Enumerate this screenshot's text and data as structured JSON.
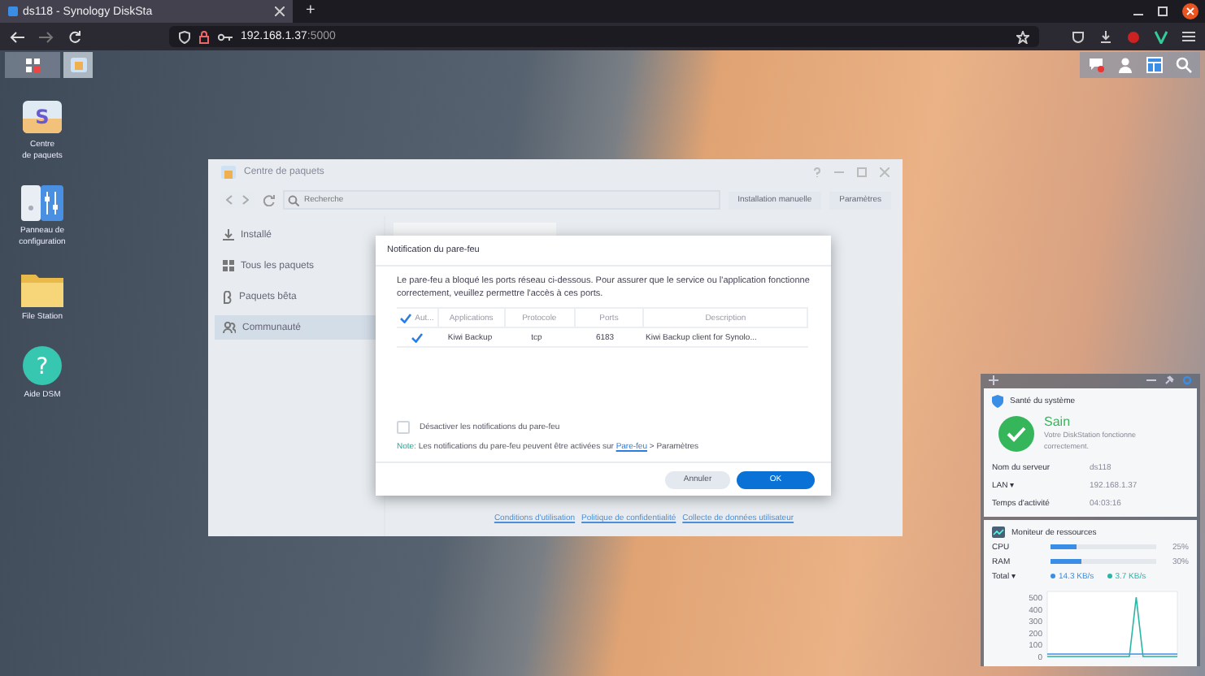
{
  "browser": {
    "tab_title": "ds118 - Synology DiskSta",
    "new_tab": "+",
    "url_host": "192.168.1.37",
    "url_port": ":5000"
  },
  "desktop_icons": [
    {
      "kind": "package",
      "glyph": "S",
      "lines": [
        "Centre",
        "de paquets"
      ]
    },
    {
      "kind": "config",
      "lines": [
        "Panneau de",
        "configuration"
      ]
    },
    {
      "kind": "folder",
      "lines": [
        "File Station"
      ]
    },
    {
      "kind": "help",
      "glyph": "?",
      "lines": [
        "Aide DSM"
      ]
    }
  ],
  "package_center": {
    "title": "Centre de paquets",
    "search": {
      "placeholder": "Recherche"
    },
    "buttons": [
      "Installation manuelle",
      "Paramètres"
    ],
    "sidebar": [
      {
        "label": "Installé",
        "kind": "download",
        "selected": false
      },
      {
        "label": "Tous les paquets",
        "kind": "grid",
        "selected": false
      },
      {
        "label": "Paquets bêta",
        "kind": "beta",
        "selected": false
      },
      {
        "label": "Communauté",
        "kind": "people",
        "selected": true
      }
    ],
    "footer_links": [
      "Conditions d'utilisation",
      "Politique de confidentialité",
      "Collecte de données utilisateur"
    ]
  },
  "dialog": {
    "title": "Notification du pare-feu",
    "message": "Le pare-feu a bloqué les ports réseau ci-dessous. Pour assurer que le service ou l'application fonctionne correctement, veuillez permettre l'accès à ces ports.",
    "table": {
      "header_checked": true,
      "columns": [
        "Aut...",
        "Applications",
        "Protocole",
        "Ports",
        "Description"
      ],
      "rows": [
        {
          "checked": true,
          "cells": [
            "",
            "Kiwi Backup",
            "tcp",
            "6183",
            "Kiwi Backup client for Synolo..."
          ]
        }
      ]
    },
    "disable_option": {
      "label": "Désactiver les notifications du pare-feu",
      "checked": false
    },
    "note": {
      "prefix": "Note:",
      "text": "Les notifications du pare-feu peuvent être activées sur",
      "link": "Pare-feu",
      "suffix": "> Paramètres"
    },
    "buttons": [
      {
        "label": "Annuler",
        "kind": "secondary"
      },
      {
        "label": "OK",
        "kind": "primary"
      }
    ]
  },
  "health_widget": {
    "title": "Santé du système",
    "status": "Sain",
    "description": "Votre DiskStation fonctionne correctement.",
    "rows": [
      {
        "label": "Nom du serveur",
        "value": "ds118"
      },
      {
        "label": "LAN ▾",
        "value": "192.168.1.37"
      },
      {
        "label": "Temps d'activité",
        "value": "04:03:16"
      }
    ]
  },
  "resource_widget": {
    "title": "Moniteur de ressources",
    "meters": [
      {
        "label": "CPU",
        "level": 0.25,
        "reading": "25%"
      },
      {
        "label": "RAM",
        "level": 0.3,
        "reading": "30%"
      }
    ],
    "network": {
      "label": "Total ▾",
      "readings": [
        {
          "text": "14.3 KB/s",
          "color": "#3a8ee6"
        },
        {
          "text": "3.7 KB/s",
          "color": "#2ab5a5"
        }
      ]
    },
    "chart_data": {
      "type": "line",
      "ylim": [
        0,
        550
      ],
      "yticks": [
        0,
        100,
        200,
        300,
        400,
        500
      ],
      "series": [
        {
          "color": "#3a8ee6",
          "values": [
            20,
            20,
            20,
            20,
            20,
            20,
            20,
            20,
            20,
            20,
            20,
            20,
            20,
            20,
            20,
            20,
            20,
            20,
            20,
            20
          ]
        },
        {
          "color": "#2ab5a5",
          "values": [
            0,
            0,
            0,
            0,
            0,
            0,
            0,
            0,
            0,
            0,
            0,
            0,
            0,
            500,
            0,
            0,
            0,
            0,
            0,
            0
          ]
        }
      ]
    }
  }
}
